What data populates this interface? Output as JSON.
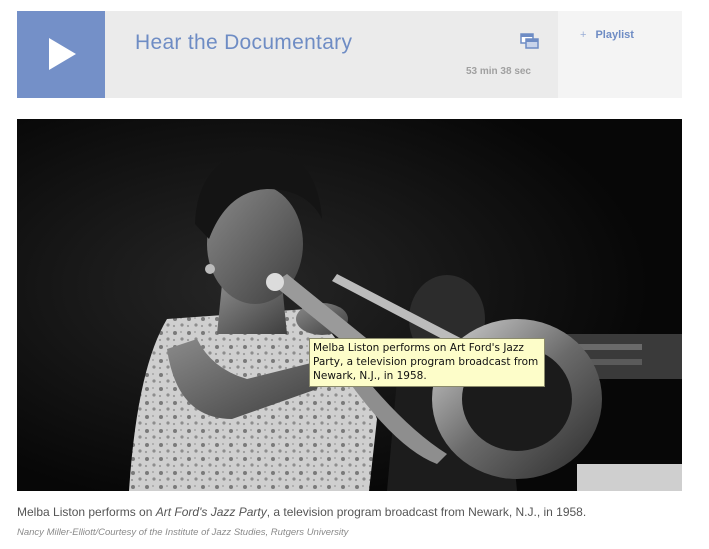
{
  "player": {
    "title": "Hear the Documentary",
    "duration": "53 min 38 sec",
    "playlist_label": "Playlist",
    "playlist_prefix": "+",
    "colors": {
      "accent": "#7490c8",
      "title": "#6e8cc4",
      "bar_background": "#ebebeb",
      "playlist_background": "#f4f4f4"
    },
    "icons": {
      "play": "play-icon",
      "popout": "popout-window-icon",
      "add": "plus-icon"
    }
  },
  "photo": {
    "tooltip": "Melba Liston performs on Art Ford's Jazz Party, a television program broadcast from Newark, N.J., in 1958."
  },
  "caption": {
    "before": "Melba Liston performs on ",
    "italic": "Art Ford's Jazz Party",
    "after": ", a television program broadcast from Newark, N.J., in 1958.",
    "credit": "Nancy Miller-Elliott/Courtesy of the Institute of Jazz Studies, Rutgers University"
  }
}
